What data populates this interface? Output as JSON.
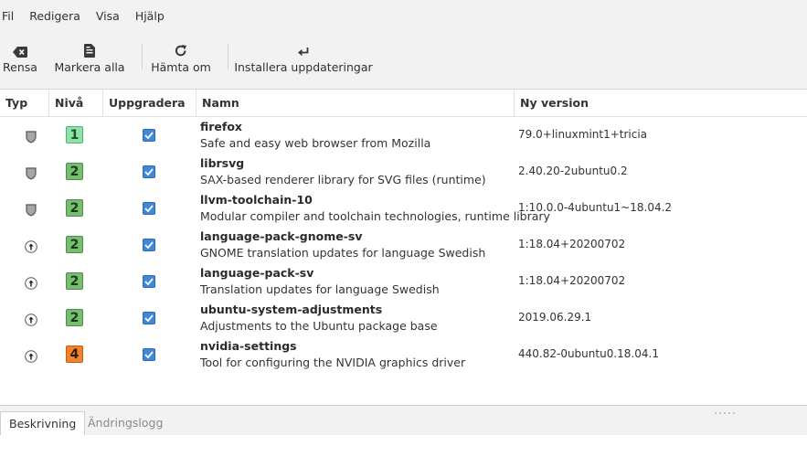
{
  "menubar": {
    "items": [
      "Fil",
      "Redigera",
      "Visa",
      "Hjälp"
    ]
  },
  "toolbar": {
    "clear_label": "Rensa",
    "select_all_label": "Markera alla",
    "refresh_label": "Hämta om",
    "install_label": "Installera uppdateringar"
  },
  "table": {
    "columns": {
      "type": "Typ",
      "level": "Nivå",
      "upgrade": "Uppgradera",
      "name": "Namn",
      "new_version": "Ny version"
    },
    "rows": [
      {
        "type": "security",
        "level": "1",
        "checked": true,
        "name": "firefox",
        "description": "Safe and easy web browser from Mozilla",
        "version": "79.0+linuxmint1+tricia"
      },
      {
        "type": "security",
        "level": "2",
        "checked": true,
        "name": "librsvg",
        "description": "SAX-based renderer library for SVG files (runtime)",
        "version": "2.40.20-2ubuntu0.2"
      },
      {
        "type": "security",
        "level": "2",
        "checked": true,
        "name": "llvm-toolchain-10",
        "description": "Modular compiler and toolchain technologies, runtime library",
        "version": "1:10.0.0-4ubuntu1~18.04.2"
      },
      {
        "type": "upgrade",
        "level": "2",
        "checked": true,
        "name": "language-pack-gnome-sv",
        "description": "GNOME translation updates for language Swedish",
        "version": "1:18.04+20200702"
      },
      {
        "type": "upgrade",
        "level": "2",
        "checked": true,
        "name": "language-pack-sv",
        "description": "Translation updates for language Swedish",
        "version": "1:18.04+20200702"
      },
      {
        "type": "upgrade",
        "level": "2",
        "checked": true,
        "name": "ubuntu-system-adjustments",
        "description": "Adjustments to the Ubuntu package base",
        "version": "2019.06.29.1"
      },
      {
        "type": "upgrade",
        "level": "4",
        "checked": true,
        "name": "nvidia-settings",
        "description": "Tool for configuring the NVIDIA graphics driver",
        "version": "440.82-0ubuntu0.18.04.1"
      }
    ]
  },
  "tabs": {
    "description": "Beskrivning",
    "changelog": "Ändringslogg"
  },
  "colors": {
    "check": "#3e88d6",
    "level1": "#8ee2a8",
    "level2": "#79bd72",
    "level4": "#f0832f"
  }
}
